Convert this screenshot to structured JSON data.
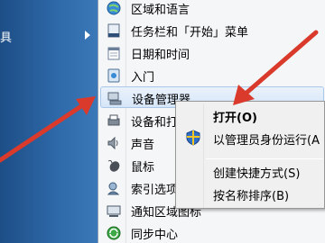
{
  "left_menu": {
    "item_label": "具",
    "arrow_icon": "chevron-right-icon"
  },
  "submenu": {
    "items": [
      {
        "label": "区域和语言",
        "icon": "globe-clock-icon"
      },
      {
        "label": "任务栏和「开始」菜单",
        "icon": "taskbar-icon"
      },
      {
        "label": "日期和时间",
        "icon": "calendar-icon"
      },
      {
        "label": "入门",
        "icon": "getting-started-icon"
      },
      {
        "label": "设备管理器",
        "icon": "device-manager-icon"
      },
      {
        "label": "设备和打",
        "icon": "printer-icon"
      },
      {
        "label": "声音",
        "icon": "speaker-icon"
      },
      {
        "label": "鼠标",
        "icon": "mouse-icon"
      },
      {
        "label": "索引选项",
        "icon": "indexing-icon"
      },
      {
        "label": "通知区域图标",
        "icon": "notification-icon"
      },
      {
        "label": "同步中心",
        "icon": "sync-center-icon"
      }
    ]
  },
  "context_menu": {
    "open": "打开(O)",
    "run_as_admin": "以管理员身份运行(A",
    "create_shortcut": "创建快捷方式(S)",
    "sort_by_name": "按名称排序(B)"
  },
  "colors": {
    "arrow": "#d93a2b",
    "hover": "#d6e6f8",
    "left_panel": "#2f6aaa"
  }
}
